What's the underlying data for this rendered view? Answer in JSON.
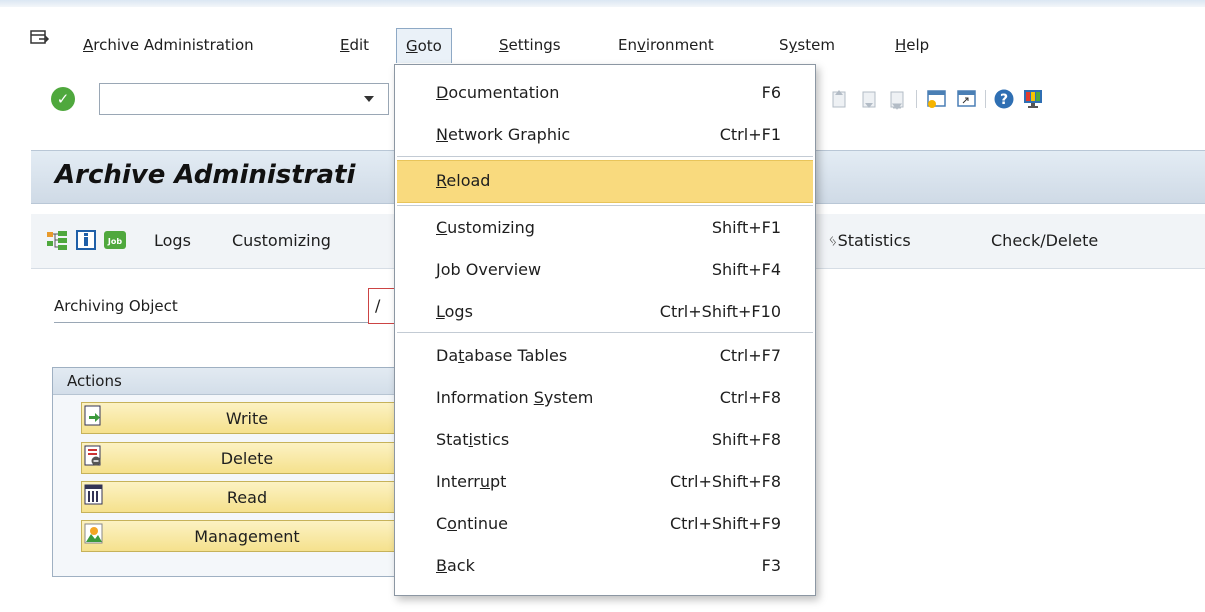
{
  "menubar": {
    "items": [
      {
        "label": "Archive Administration",
        "accel": "A",
        "rest": "rchive Administration"
      },
      {
        "label": "Edit",
        "accel": "E",
        "rest": "dit"
      },
      {
        "label": "Goto",
        "accel": "G",
        "rest": "oto"
      },
      {
        "label": "Settings",
        "accel": "S",
        "rest": "ettings"
      },
      {
        "label": "Environment",
        "pre": "En",
        "accel": "v",
        "rest": "ironment"
      },
      {
        "label": "System",
        "pre": "S",
        "accel": "y",
        "rest": "stem"
      },
      {
        "label": "Help",
        "accel": "H",
        "rest": "elp"
      }
    ]
  },
  "toolbar": {
    "command_field_value": ""
  },
  "title": "Archive Administrati",
  "app_toolbar": {
    "buttons": [
      {
        "label": "Logs"
      },
      {
        "label": "Customizing"
      },
      {
        "label": "Statistics"
      },
      {
        "label": "Check/Delete"
      }
    ]
  },
  "form": {
    "archiving_object_label": "Archiving Object",
    "archiving_object_value": "/"
  },
  "actions": {
    "title": "Actions",
    "buttons": [
      {
        "label": "Write",
        "icon": "write-icon"
      },
      {
        "label": "Delete",
        "icon": "delete-icon"
      },
      {
        "label": "Read",
        "icon": "read-icon"
      },
      {
        "label": "Management",
        "icon": "management-icon"
      }
    ]
  },
  "goto_menu": {
    "items": [
      {
        "pre": "",
        "accel": "D",
        "rest": "ocumentation",
        "shortcut": "F6"
      },
      {
        "pre": "",
        "accel": "N",
        "rest": "etwork Graphic",
        "shortcut": "Ctrl+F1"
      },
      {
        "pre": "",
        "accel": "R",
        "rest": "eload",
        "shortcut": ""
      },
      {
        "pre": "",
        "accel": "C",
        "rest": "ustomizing",
        "shortcut": "Shift+F1"
      },
      {
        "pre": "",
        "accel": "J",
        "rest": "ob Overview",
        "shortcut": "Shift+F4"
      },
      {
        "pre": "",
        "accel": "L",
        "rest": "ogs",
        "shortcut": "Ctrl+Shift+F10"
      },
      {
        "pre": "Da",
        "accel": "t",
        "rest": "abase Tables",
        "shortcut": "Ctrl+F7"
      },
      {
        "pre": "Information ",
        "accel": "S",
        "rest": "ystem",
        "shortcut": "Ctrl+F8"
      },
      {
        "pre": "Stat",
        "accel": "i",
        "rest": "stics",
        "shortcut": "Shift+F8"
      },
      {
        "pre": "Interr",
        "accel": "u",
        "rest": "pt",
        "shortcut": "Ctrl+Shift+F8"
      },
      {
        "pre": "C",
        "accel": "o",
        "rest": "ntinue",
        "shortcut": "Ctrl+Shift+F9"
      },
      {
        "pre": "",
        "accel": "B",
        "rest": "ack",
        "shortcut": "F3"
      }
    ],
    "highlighted_index": 2
  },
  "colors": {
    "highlight": "#f9da7e",
    "action_button": "#f5e18d",
    "ok_green": "#4fa83d",
    "title_bar": "#d6e0ea"
  }
}
